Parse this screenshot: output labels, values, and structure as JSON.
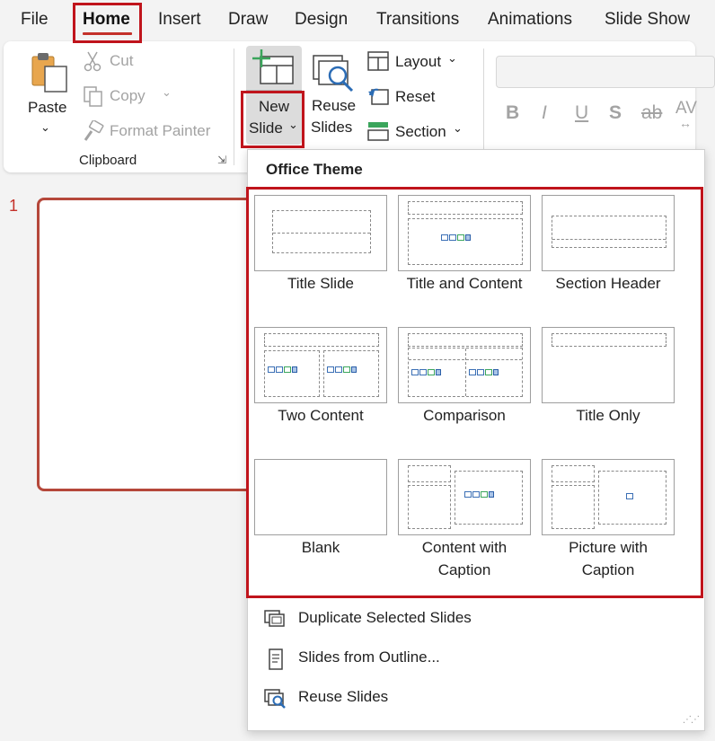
{
  "menu": {
    "tabs": [
      "File",
      "Home",
      "Insert",
      "Draw",
      "Design",
      "Transitions",
      "Animations",
      "Slide Show"
    ]
  },
  "ribbon": {
    "clipboard": {
      "paste": "Paste",
      "cut": "Cut",
      "copy": "Copy",
      "format_painter": "Format Painter",
      "group_label": "Clipboard"
    },
    "slides": {
      "new_slide_line1": "New",
      "new_slide_line2": "Slide",
      "reuse_line1": "Reuse",
      "reuse_line2": "Slides",
      "layout": "Layout",
      "reset": "Reset",
      "section": "Section"
    },
    "font": {
      "bold": "B",
      "italic": "I",
      "underline": "U",
      "shadow": "S",
      "strike": "ab",
      "spacing": "AV"
    }
  },
  "slide_panel": {
    "slide_number": "1"
  },
  "dropdown": {
    "title": "Office Theme",
    "layouts": [
      {
        "line1": "Title Slide",
        "line2": ""
      },
      {
        "line1": "Title and Content",
        "line2": ""
      },
      {
        "line1": "Section Header",
        "line2": ""
      },
      {
        "line1": "Two Content",
        "line2": ""
      },
      {
        "line1": "Comparison",
        "line2": ""
      },
      {
        "line1": "Title Only",
        "line2": ""
      },
      {
        "line1": "Blank",
        "line2": ""
      },
      {
        "line1": "Content with",
        "line2": "Caption"
      },
      {
        "line1": "Picture with",
        "line2": "Caption"
      }
    ],
    "actions": {
      "duplicate": "Duplicate Selected Slides",
      "outline": "Slides from Outline...",
      "reuse": "Reuse Slides"
    }
  },
  "colors": {
    "highlight": "#c0141c",
    "active_tab_underline": "#c4312a",
    "slide_border": "#b5473a"
  }
}
